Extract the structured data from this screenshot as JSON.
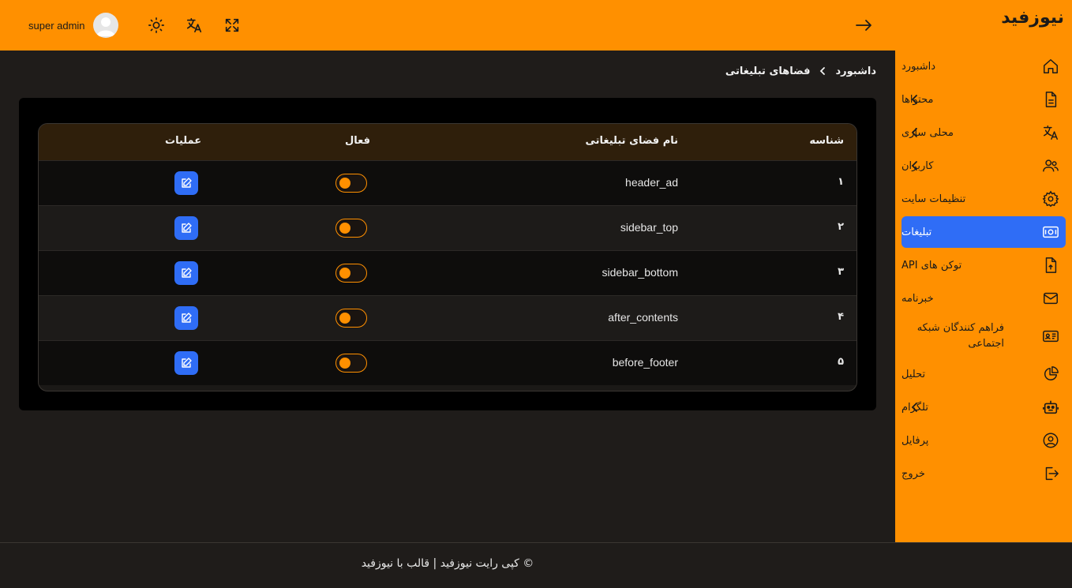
{
  "colors": {
    "brand": "#ff9000",
    "accent": "#2f6df6",
    "background": "#1f1c1a",
    "panel": "#000000",
    "table_header": "#2f1f0b"
  },
  "header": {
    "user_name": "super admin",
    "icons": [
      "avatar-icon",
      "sun-icon",
      "translate-icon",
      "fullscreen-icon",
      "arrow-right-icon"
    ]
  },
  "sidebar": {
    "logo": "نیوزفید",
    "items": [
      {
        "label": "داشبورد",
        "icon": "home-icon",
        "has_children": false,
        "active": false
      },
      {
        "label": "محتواها",
        "icon": "document-icon",
        "has_children": true,
        "active": false
      },
      {
        "label": "محلی سازی",
        "icon": "translate-icon",
        "has_children": true,
        "active": false
      },
      {
        "label": "کاربران",
        "icon": "users-icon",
        "has_children": true,
        "active": false
      },
      {
        "label": "تنظیمات سایت",
        "icon": "gear-icon",
        "has_children": false,
        "active": false
      },
      {
        "label": "تبلیغات",
        "icon": "ad-icon",
        "has_children": false,
        "active": true
      },
      {
        "label": "توکن های API",
        "icon": "file-upload-icon",
        "has_children": false,
        "active": false
      },
      {
        "label": "خبرنامه",
        "icon": "mail-icon",
        "has_children": false,
        "active": false
      },
      {
        "label": "فراهم کنندگان شبکه اجتماعی",
        "icon": "id-card-icon",
        "has_children": false,
        "active": false
      },
      {
        "label": "تحلیل",
        "icon": "pie-chart-icon",
        "has_children": false,
        "active": false
      },
      {
        "label": "تلگرام",
        "icon": "robot-icon",
        "has_children": true,
        "active": false
      },
      {
        "label": "پرفایل",
        "icon": "user-circle-icon",
        "has_children": false,
        "active": false
      },
      {
        "label": "خروج",
        "icon": "logout-icon",
        "has_children": false,
        "active": false
      }
    ]
  },
  "breadcrumb": {
    "root": "داشبورد",
    "current": "فضاهای تبلیغاتی"
  },
  "table": {
    "headers": {
      "id": "شناسه",
      "name": "نام فضای تبلیغاتی",
      "active": "فعال",
      "actions": "عملیات"
    },
    "rows": [
      {
        "id": "۱",
        "name": "header_ad",
        "active": false
      },
      {
        "id": "۲",
        "name": "sidebar_top",
        "active": false
      },
      {
        "id": "۳",
        "name": "sidebar_bottom",
        "active": false
      },
      {
        "id": "۴",
        "name": "after_contents",
        "active": false
      },
      {
        "id": "۵",
        "name": "before_footer",
        "active": false
      }
    ]
  },
  "footer": {
    "text": "© کپی رایت نیوزفید | قالب با نیوزفید"
  }
}
